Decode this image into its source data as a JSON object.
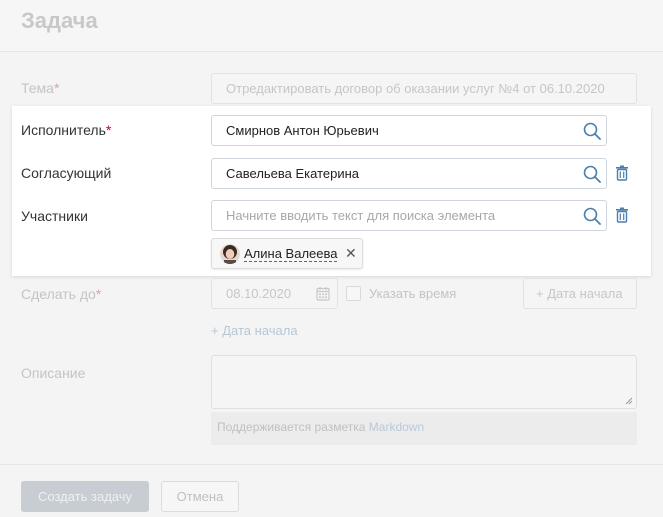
{
  "header": {
    "title": "Задача"
  },
  "form": {
    "topic": {
      "label": "Тема",
      "required_mark": "*",
      "value": "Отредактировать договор об оказании услуг №4 от 06.10.2020"
    },
    "assignee": {
      "label": "Исполнитель",
      "required_mark": "*",
      "value": "Смирнов Антон Юрьевич"
    },
    "approver": {
      "label": "Согласующий",
      "value": "Савельева Екатерина"
    },
    "participants": {
      "label": "Участники",
      "placeholder": "Начните вводить текст для поиска элемента",
      "chips": [
        {
          "name": "Алина Валеева",
          "remove": "✕"
        }
      ]
    },
    "due": {
      "label": "Сделать до",
      "required_mark": "*",
      "date": "08.10.2020",
      "time_checkbox_label": "Указать время",
      "start_date_button": "+ Дата начала",
      "start_date_link": "+ Дата начала"
    },
    "description": {
      "label": "Описание",
      "hint_prefix": "Поддерживается разметка",
      "hint_link": "Markdown"
    }
  },
  "footer": {
    "create_button": "Создать задачу",
    "cancel_button": "Отмена"
  },
  "colors": {
    "required": "#d0021b",
    "icon_blue": "#4a7fae",
    "link": "#b7c7d6"
  }
}
